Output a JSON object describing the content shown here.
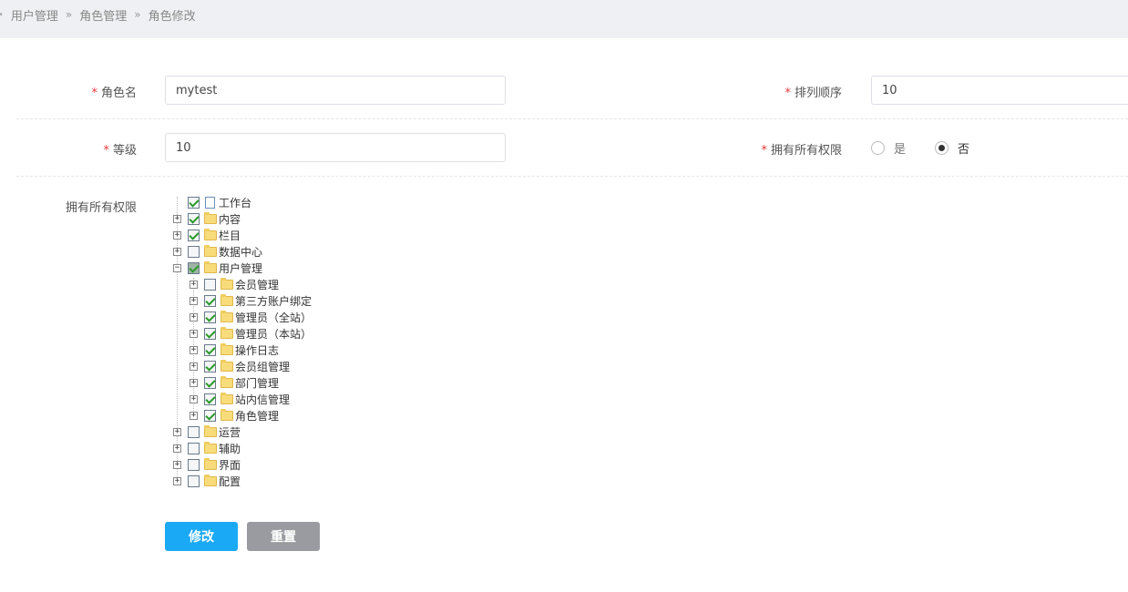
{
  "breadcrumb": [
    "用户管理",
    "角色管理",
    "角色修改"
  ],
  "breadcrumb_sep": "»",
  "form": {
    "role_name": {
      "label": "角色名",
      "value": "mytest"
    },
    "sort_order": {
      "label": "排列顺序",
      "value": "10"
    },
    "level": {
      "label": "等级",
      "value": "10"
    },
    "all_permissions": {
      "label": "拥有所有权限",
      "options": [
        "是",
        "否"
      ],
      "selected": "否"
    },
    "permissions_label": "拥有所有权限",
    "required_mark": "*"
  },
  "tree": [
    {
      "label": "工作台",
      "level": 0,
      "state": "checked",
      "icon": "file",
      "expander": "none"
    },
    {
      "label": "内容",
      "level": 0,
      "state": "checked",
      "icon": "folder",
      "expander": "plus"
    },
    {
      "label": "栏目",
      "level": 0,
      "state": "checked",
      "icon": "folder",
      "expander": "plus"
    },
    {
      "label": "数据中心",
      "level": 0,
      "state": "unchecked",
      "icon": "folder",
      "expander": "plus"
    },
    {
      "label": "用户管理",
      "level": 0,
      "state": "partial",
      "icon": "folder-open",
      "expander": "minus"
    },
    {
      "label": "会员管理",
      "level": 1,
      "state": "unchecked",
      "icon": "folder",
      "expander": "plus"
    },
    {
      "label": "第三方账户绑定",
      "level": 1,
      "state": "checked",
      "icon": "folder",
      "expander": "plus"
    },
    {
      "label": "管理员（全站）",
      "level": 1,
      "state": "checked",
      "icon": "folder",
      "expander": "plus"
    },
    {
      "label": "管理员（本站）",
      "level": 1,
      "state": "checked",
      "icon": "folder",
      "expander": "plus"
    },
    {
      "label": "操作日志",
      "level": 1,
      "state": "checked",
      "icon": "folder",
      "expander": "plus"
    },
    {
      "label": "会员组管理",
      "level": 1,
      "state": "checked",
      "icon": "folder",
      "expander": "plus"
    },
    {
      "label": "部门管理",
      "level": 1,
      "state": "checked",
      "icon": "folder",
      "expander": "plus"
    },
    {
      "label": "站内信管理",
      "level": 1,
      "state": "checked",
      "icon": "folder",
      "expander": "plus"
    },
    {
      "label": "角色管理",
      "level": 1,
      "state": "checked",
      "icon": "folder",
      "expander": "plus"
    },
    {
      "label": "运营",
      "level": 0,
      "state": "unchecked",
      "icon": "folder",
      "expander": "plus"
    },
    {
      "label": "辅助",
      "level": 0,
      "state": "unchecked",
      "icon": "folder",
      "expander": "plus"
    },
    {
      "label": "界面",
      "level": 0,
      "state": "unchecked",
      "icon": "folder",
      "expander": "plus"
    },
    {
      "label": "配置",
      "level": 0,
      "state": "unchecked",
      "icon": "folder",
      "expander": "plus"
    }
  ],
  "buttons": {
    "submit": "修改",
    "reset": "重置"
  },
  "colors": {
    "primary": "#1aa9f5",
    "secondary": "#9a9ba0",
    "required": "#e4393c"
  }
}
